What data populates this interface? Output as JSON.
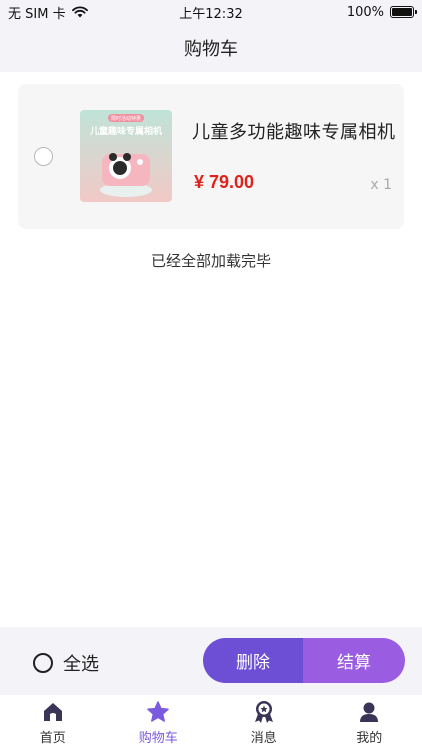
{
  "status_bar": {
    "carrier": "无 SIM 卡",
    "time": "上午12:32",
    "battery_percent": "100%"
  },
  "header": {
    "title": "购物车"
  },
  "cart": {
    "items": [
      {
        "name": "儿童多功能趣味专属相机",
        "price": "¥ 79.00",
        "quantity": "x 1",
        "selected": false,
        "image": {
          "banner_text": "儿童趣味专属相机",
          "badge_text": "限时活动特惠"
        }
      }
    ],
    "load_complete_text": "已经全部加载完毕"
  },
  "action_bar": {
    "select_all_label": "全选",
    "delete_label": "删除",
    "checkout_label": "结算"
  },
  "tab_bar": {
    "active": 1,
    "items": [
      {
        "label": "首页",
        "icon": "home-icon"
      },
      {
        "label": "购物车",
        "icon": "star-icon"
      },
      {
        "label": "消息",
        "icon": "medal-icon"
      },
      {
        "label": "我的",
        "icon": "person-icon"
      }
    ]
  },
  "colors": {
    "accent": "#7c5ae0",
    "delete": "#6d4fd6",
    "checkout": "#9a5ce0",
    "price": "#e0221a"
  }
}
